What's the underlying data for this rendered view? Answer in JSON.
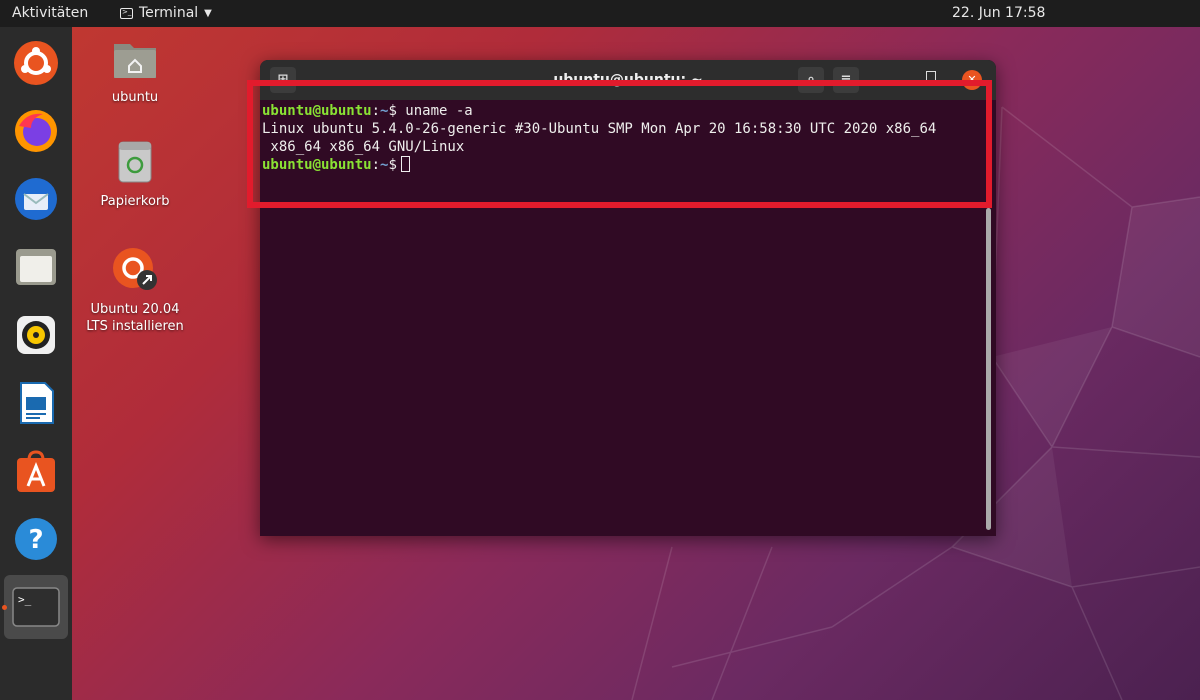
{
  "topbar": {
    "activities": "Aktivitäten",
    "app_menu": "Terminal",
    "clock": "22. Jun  17:58"
  },
  "dock": {
    "items": [
      "ubuntu-icon",
      "firefox-icon",
      "thunderbird-icon",
      "files-icon",
      "rhythmbox-icon",
      "libreoffice-writer-icon",
      "software-center-icon",
      "help-icon",
      "terminal-icon"
    ],
    "accent_color": "#e95420"
  },
  "desktop": {
    "icons": [
      {
        "label": "ubuntu"
      },
      {
        "label": "Papierkorb"
      },
      {
        "label": "Ubuntu 20.04 LTS installieren"
      }
    ]
  },
  "terminal": {
    "title": "ubuntu@ubuntu: ~",
    "lines": [
      {
        "user": "ubuntu@ubuntu",
        "path": "~",
        "cmd": "$ uname -a"
      },
      {
        "text": "Linux ubuntu 5.4.0-26-generic #30-Ubuntu SMP Mon Apr 20 16:58:30 UTC 2020 x86_64"
      },
      {
        "text": " x86_64 x86_64 GNU/Linux"
      },
      {
        "user": "ubuntu@ubuntu",
        "path": "~",
        "cmd": "$"
      }
    ],
    "colors": {
      "background": "#300a24",
      "user": "#8ae234",
      "path": "#729fcf"
    }
  },
  "annotation": {
    "highlight_color": "#e21b2c"
  }
}
